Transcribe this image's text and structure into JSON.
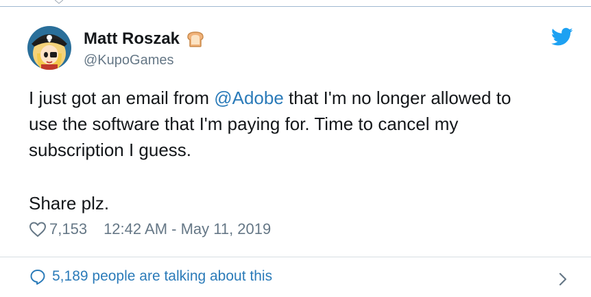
{
  "tweet": {
    "display_name": "Matt Roszak",
    "handle": "@KupoGames",
    "text_lines": [
      {
        "before": "I just got an email from ",
        "mention": "@Adobe",
        "after": " that I'm no longer allowed to"
      },
      {
        "before": "use the software that I'm paying for. Time to cancel my"
      },
      {
        "before": "subscription I guess."
      }
    ],
    "share_text": "Share plz.",
    "like_count": "7,153",
    "timestamp": "12:42 AM - May 11, 2019",
    "talking_text": "5,189 people are talking about this"
  },
  "icons": {
    "avatar": "pirate-avatar",
    "name_badge": "bread-icon",
    "brand": "twitter-bird-icon",
    "like": "heart-outline-icon",
    "reply": "speech-bubble-icon",
    "more": "chevron-right-icon"
  },
  "colors": {
    "text": "#14171a",
    "secondary": "#657786",
    "link": "#2b7bb9",
    "twitter_blue": "#1da1f2"
  }
}
